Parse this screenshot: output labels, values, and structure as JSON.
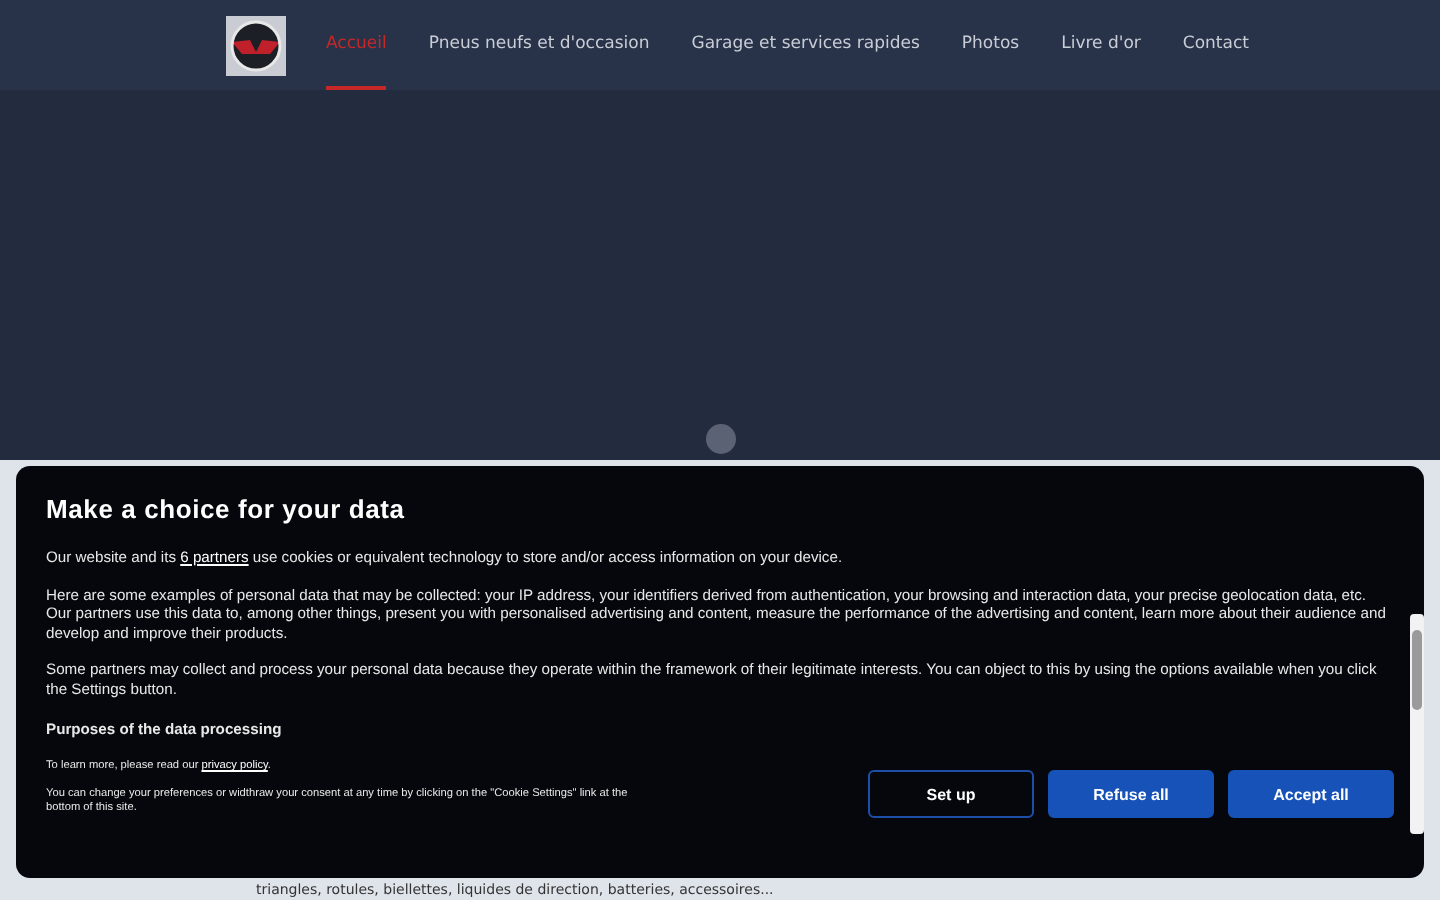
{
  "nav": {
    "items": [
      {
        "label": "Accueil",
        "selected": true
      },
      {
        "label": "Pneus neufs et d'occasion",
        "selected": false
      },
      {
        "label": "Garage et services rapides",
        "selected": false
      },
      {
        "label": "Photos",
        "selected": false
      },
      {
        "label": "Livre d'or",
        "selected": false
      },
      {
        "label": "Contact",
        "selected": false
      }
    ]
  },
  "hero": {
    "slides": [
      {
        "selected": true
      }
    ]
  },
  "page": {
    "text": "triangles, rotules, biellettes, liquides de direction, batteries, accessoires..."
  },
  "consent": {
    "title": "Make a choice for your data",
    "intro_before": "Our website and its ",
    "partners_link": "6 partners",
    "intro_after": " use cookies or equivalent technology to store and/or access information on your device.",
    "paragraphs": [
      "Here are some examples of personal data that may be collected: your IP address, your identifiers derived from authentication, your browsing and interaction data, your precise geolocation data, etc.",
      "Our partners use this data to, among other things, present you with personalised advertising and content, measure the performance of the advertising and content, learn more about their audience and develop and improve their products."
    ],
    "legitimate": "Some partners may collect and process your personal data because they operate within the framework of their legitimate interests. You can object to this by using the options available when you click the Settings button.",
    "purposes_heading": "Purposes of the data processing",
    "learn_before": "To learn more, please read our ",
    "privacy_link": "privacy policy",
    "learn_after": ".",
    "change_note": "You can change your preferences or widthraw your consent at any time by clicking on the \"Cookie Settings\" link at the bottom of this site.",
    "buttons": [
      {
        "label": "Set up",
        "kind": "outline"
      },
      {
        "label": "Refuse all",
        "kind": "filled"
      },
      {
        "label": "Accept all",
        "kind": "filled"
      }
    ]
  }
}
